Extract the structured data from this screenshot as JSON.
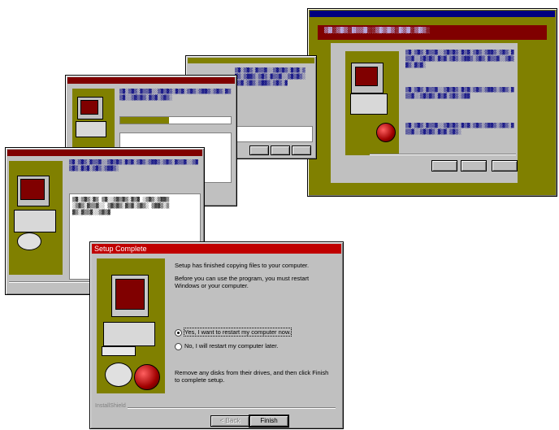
{
  "main_dialog": {
    "title": "Setup Complete",
    "line1": "Setup has finished copying files to your computer.",
    "line2": "Before you can use the program, you must restart Windows or your computer.",
    "option_yes": "Yes, I want to restart my computer now.",
    "option_no": "No, I will restart my computer later.",
    "line3": "Remove any disks from their drives, and then click Finish to complete setup.",
    "footer_label": "InstallShield",
    "back_button": "< Back",
    "finish_button": "Finish"
  },
  "colors": {
    "title": "#c00000",
    "olive": "#808000",
    "face": "#c0c0c0",
    "navy": "#000080"
  }
}
